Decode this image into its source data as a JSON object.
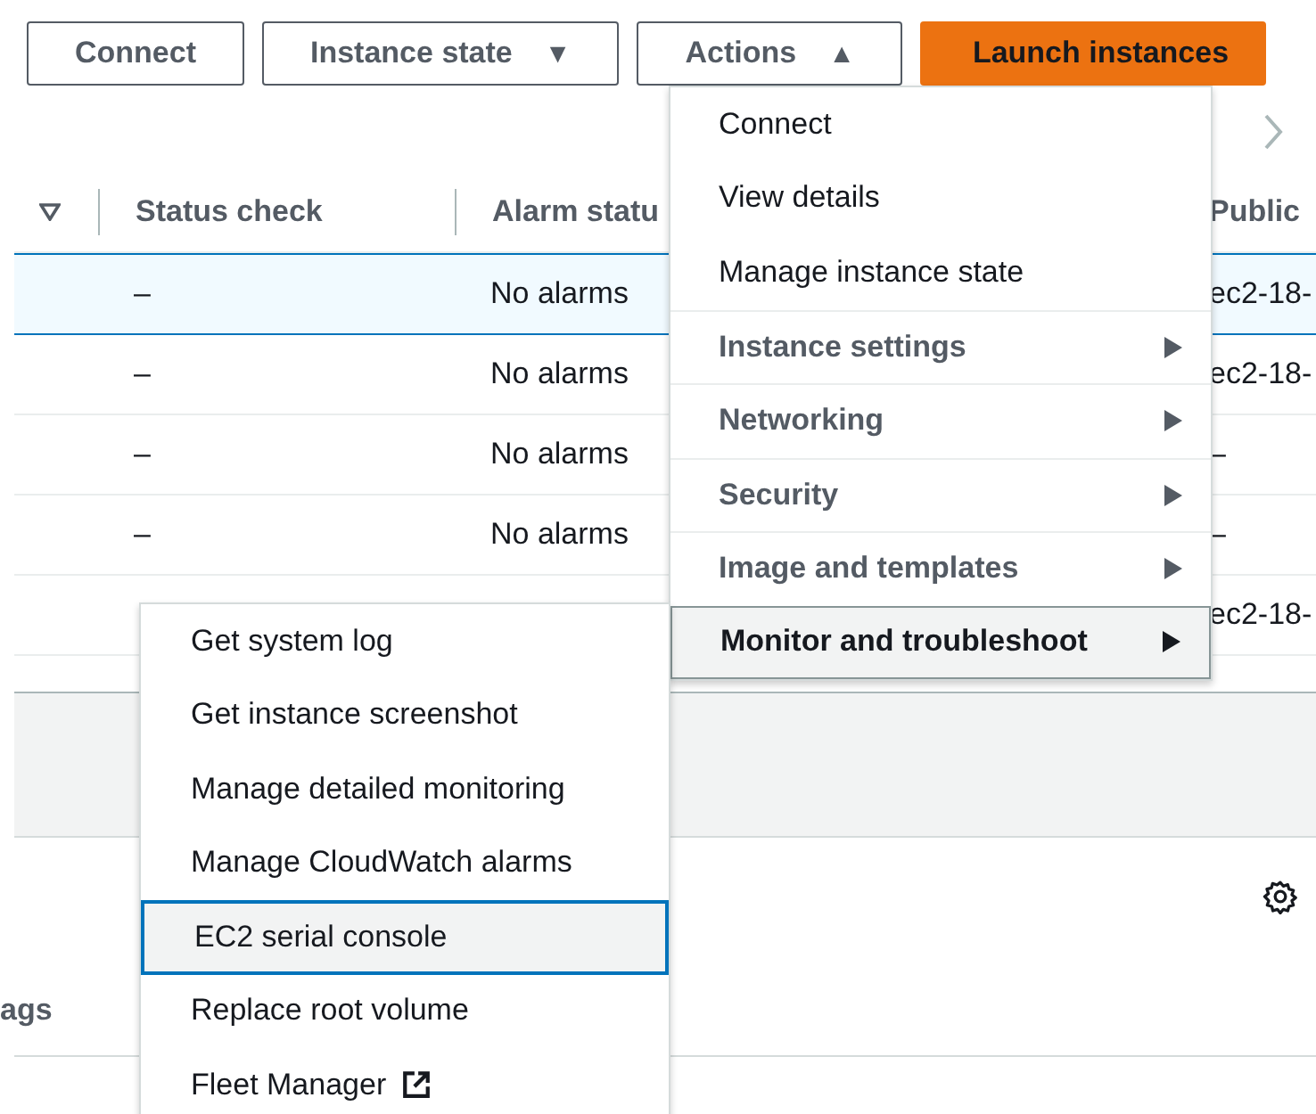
{
  "toolbar": {
    "buttons": [
      {
        "label": "Connect",
        "kind": "plain"
      },
      {
        "label": "Instance state",
        "kind": "plain",
        "caret": "▼"
      },
      {
        "label": "Actions",
        "kind": "plain",
        "caret": "▲"
      },
      {
        "label": "Launch instances",
        "kind": "primary"
      }
    ]
  },
  "table": {
    "columns": [
      "Status check",
      "Alarm statu",
      "Public"
    ],
    "rows": [
      {
        "selected": true,
        "status_check": "–",
        "alarm_status": "No alarms",
        "public": "ec2-18-"
      },
      {
        "selected": false,
        "status_check": "–",
        "alarm_status": "No alarms",
        "public": "ec2-18-"
      },
      {
        "selected": false,
        "status_check": "–",
        "alarm_status": "No alarms",
        "public": "–"
      },
      {
        "selected": false,
        "status_check": "–",
        "alarm_status": "No alarms",
        "public": "–"
      },
      {
        "selected": false,
        "public": "ec2-18-"
      }
    ]
  },
  "details": {
    "tab": "ags"
  },
  "actions_menu": {
    "items": [
      {
        "label": "Connect",
        "kind": "item",
        "expanded": false
      },
      {
        "label": "View details",
        "kind": "item",
        "expanded": false
      },
      {
        "label": "Manage instance state",
        "kind": "item",
        "expanded": false
      },
      {
        "label": "Instance settings",
        "kind": "submenu",
        "expanded": false
      },
      {
        "label": "Networking",
        "kind": "submenu",
        "expanded": false
      },
      {
        "label": "Security",
        "kind": "submenu",
        "expanded": false
      },
      {
        "label": "Image and templates",
        "kind": "submenu",
        "expanded": false
      },
      {
        "label": "Monitor and troubleshoot",
        "kind": "submenu",
        "expanded": true
      }
    ]
  },
  "submenu": {
    "items": [
      {
        "label": "Get system log",
        "focused": false,
        "external": false
      },
      {
        "label": "Get instance screenshot",
        "focused": false,
        "external": false
      },
      {
        "label": "Manage detailed monitoring",
        "focused": false,
        "external": false
      },
      {
        "label": "Manage CloudWatch alarms",
        "focused": false,
        "external": false
      },
      {
        "label": "EC2 serial console",
        "focused": true,
        "external": false
      },
      {
        "label": "Replace root volume",
        "focused": false,
        "external": false
      },
      {
        "label": "Fleet Manager",
        "focused": false,
        "external": true
      }
    ]
  }
}
